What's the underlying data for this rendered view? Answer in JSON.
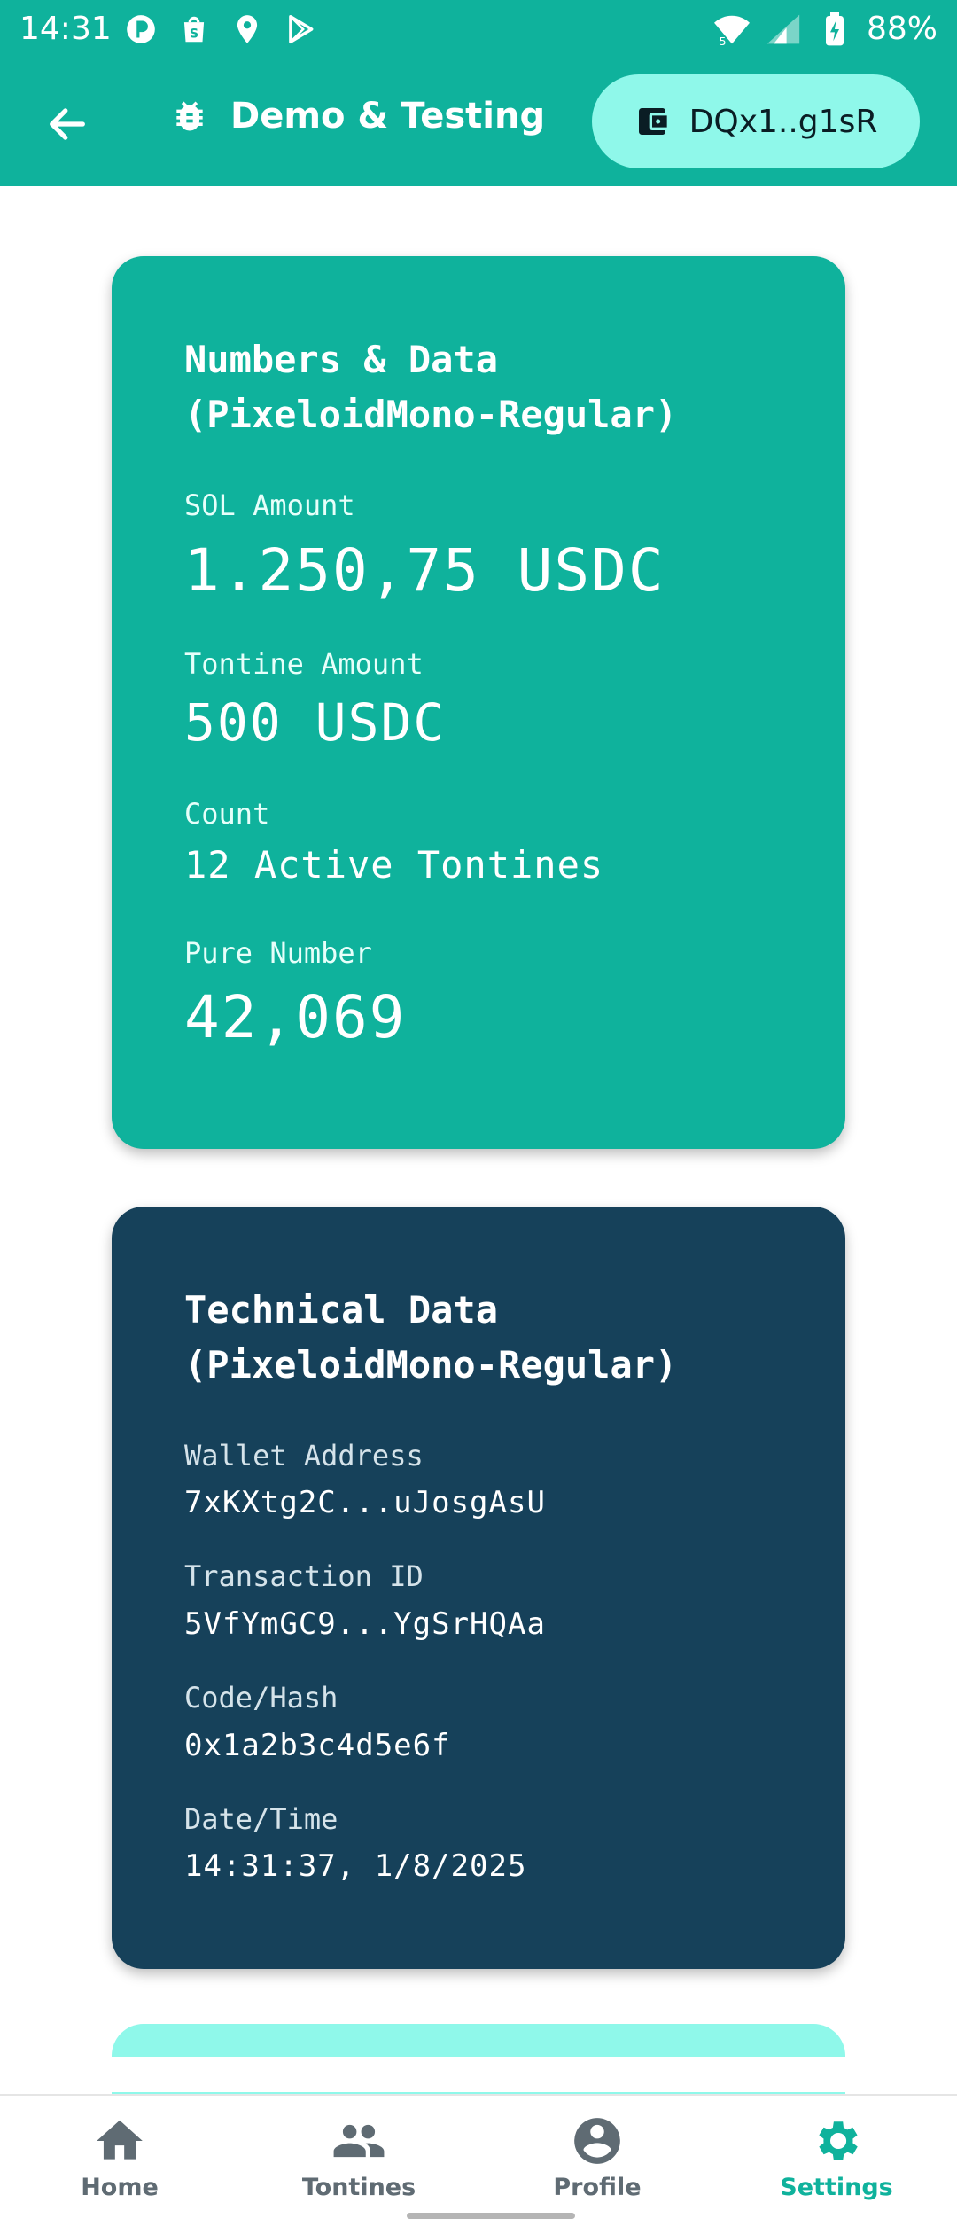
{
  "status_bar": {
    "time": "14:31",
    "battery": "88%",
    "left_icons": [
      "app-notification-icon",
      "shopping-bag-icon",
      "location-pin-icon",
      "play-store-icon"
    ],
    "right_icons": [
      "wifi-icon",
      "signal-icon",
      "battery-charging-icon"
    ]
  },
  "app_bar": {
    "title": "Demo & Testing",
    "wallet_short": "DQx1..g1sR",
    "colors": {
      "background": "#0fb29c",
      "pill": "#8ff8ea"
    }
  },
  "numbers_card": {
    "title_line1": "Numbers & Data",
    "title_line2": "(PixeloidMono-Regular)",
    "fields": [
      {
        "label": "SOL Amount",
        "value": "1.250,75 USDC"
      },
      {
        "label": "Tontine Amount",
        "value": "500 USDC"
      },
      {
        "label": "Count",
        "value": "12 Active Tontines"
      },
      {
        "label": "Pure Number",
        "value": "42,069"
      }
    ],
    "color": "#0fb29c"
  },
  "technical_card": {
    "title_line1": "Technical Data",
    "title_line2": "(PixeloidMono-Regular)",
    "fields": [
      {
        "label": "Wallet Address",
        "value": "7xKXtg2C...uJosgAsU"
      },
      {
        "label": "Transaction ID",
        "value": "5VfYmGC9...YgSrHQAa"
      },
      {
        "label": "Code/Hash",
        "value": "0x1a2b3c4d5e6f"
      },
      {
        "label": "Date/Time",
        "value": "14:31:37, 1/8/2025"
      }
    ],
    "color": "#16415a"
  },
  "bottom_nav": {
    "items": [
      {
        "label": "Home",
        "icon": "home-icon"
      },
      {
        "label": "Tontines",
        "icon": "group-icon"
      },
      {
        "label": "Profile",
        "icon": "account-circle-icon"
      },
      {
        "label": "Settings",
        "icon": "gear-icon"
      }
    ],
    "active": "Settings",
    "active_color": "#0fb29c",
    "inactive_color": "#5f6b73"
  }
}
